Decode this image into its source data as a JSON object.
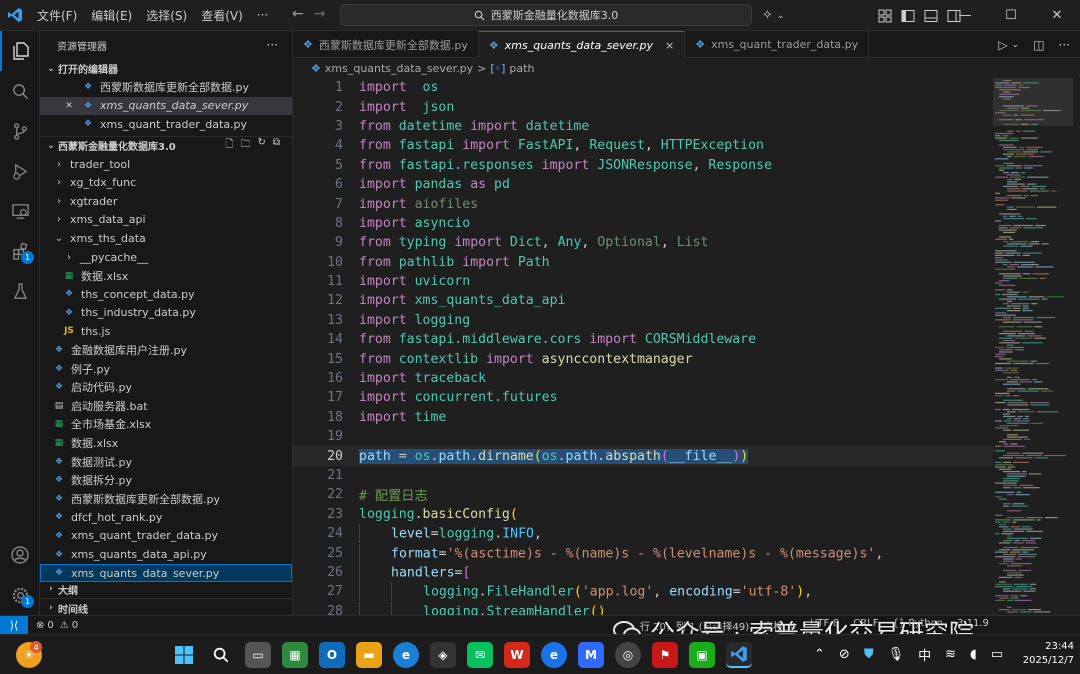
{
  "menu": [
    "文件(F)",
    "编辑(E)",
    "选择(S)",
    "查看(V)",
    "···"
  ],
  "search": {
    "text": "西蒙斯金融量化数据库3.0"
  },
  "explorer": {
    "title": "资源管理器",
    "more": "···",
    "open_editors_label": "打开的编辑器",
    "open_editors": [
      {
        "name": "西蒙斯数据库更新全部数据.py",
        "active": false
      },
      {
        "name": "xms_quants_data_sever.py",
        "active": true
      },
      {
        "name": "xms_quant_trader_data.py",
        "active": false
      }
    ],
    "workspace": "西蒙斯金融量化数据库3.0",
    "tree": [
      {
        "name": "trader_tool",
        "kind": "folder",
        "depth": 1
      },
      {
        "name": "xg_tdx_func",
        "kind": "folder",
        "depth": 1
      },
      {
        "name": "xgtrader",
        "kind": "folder",
        "depth": 1
      },
      {
        "name": "xms_data_api",
        "kind": "folder",
        "depth": 1
      },
      {
        "name": "xms_ths_data",
        "kind": "folder-open",
        "depth": 1
      },
      {
        "name": "__pycache__",
        "kind": "folder",
        "depth": 2
      },
      {
        "name": "数据.xlsx",
        "kind": "xlsx",
        "depth": 2
      },
      {
        "name": "ths_concept_data.py",
        "kind": "py",
        "depth": 2
      },
      {
        "name": "ths_industry_data.py",
        "kind": "py",
        "depth": 2
      },
      {
        "name": "ths.js",
        "kind": "js",
        "depth": 2
      },
      {
        "name": "金融数据库用户注册.py",
        "kind": "py",
        "depth": 1
      },
      {
        "name": "例子.py",
        "kind": "py",
        "depth": 1
      },
      {
        "name": "启动代码.py",
        "kind": "py",
        "depth": 1
      },
      {
        "name": "启动服务器.bat",
        "kind": "bat",
        "depth": 1
      },
      {
        "name": "全市场基金.xlsx",
        "kind": "xlsx",
        "depth": 1
      },
      {
        "name": "数据.xlsx",
        "kind": "xlsx",
        "depth": 1
      },
      {
        "name": "数据测试.py",
        "kind": "py",
        "depth": 1
      },
      {
        "name": "数据拆分.py",
        "kind": "py",
        "depth": 1
      },
      {
        "name": "西蒙斯数据库更新全部数据.py",
        "kind": "py",
        "depth": 1
      },
      {
        "name": "dfcf_hot_rank.py",
        "kind": "py",
        "depth": 1
      },
      {
        "name": "xms_quant_trader_data.py",
        "kind": "py",
        "depth": 1
      },
      {
        "name": "xms_quants_data_api.py",
        "kind": "py",
        "depth": 1
      },
      {
        "name": "xms_quants_data_sever.py",
        "kind": "py",
        "depth": 1,
        "focus": true
      }
    ],
    "outline_label": "大纲",
    "timeline_label": "时间线"
  },
  "tabs": [
    {
      "name": "西蒙斯数据库更新全部数据.py",
      "active": false
    },
    {
      "name": "xms_quants_data_sever.py",
      "active": true,
      "close": "×"
    },
    {
      "name": "xms_quant_trader_data.py",
      "active": false
    }
  ],
  "breadcrumb": {
    "file": "xms_quants_data_sever.py",
    "sep": ">",
    "symbol": "path"
  },
  "code": {
    "current_line": 20,
    "lines": [
      {
        "n": "1",
        "t": [
          [
            "k",
            "import"
          ],
          [
            "",
            "  "
          ],
          [
            "m",
            "os"
          ]
        ]
      },
      {
        "n": "2",
        "t": [
          [
            "k",
            "import"
          ],
          [
            "",
            "  "
          ],
          [
            "m",
            "json"
          ]
        ]
      },
      {
        "n": "3",
        "t": [
          [
            "k",
            "from"
          ],
          [
            "",
            " "
          ],
          [
            "m",
            "datetime"
          ],
          [
            "",
            " "
          ],
          [
            "k",
            "import"
          ],
          [
            "",
            " "
          ],
          [
            "m",
            "datetime"
          ]
        ]
      },
      {
        "n": "4",
        "t": [
          [
            "k",
            "from"
          ],
          [
            "",
            " "
          ],
          [
            "m",
            "fastapi"
          ],
          [
            "",
            " "
          ],
          [
            "k",
            "import"
          ],
          [
            "",
            " "
          ],
          [
            "m",
            "FastAPI"
          ],
          [
            "",
            ", "
          ],
          [
            "m",
            "Request"
          ],
          [
            "",
            ", "
          ],
          [
            "m",
            "HTTPException"
          ]
        ]
      },
      {
        "n": "5",
        "t": [
          [
            "k",
            "from"
          ],
          [
            "",
            " "
          ],
          [
            "m",
            "fastapi.responses"
          ],
          [
            "",
            " "
          ],
          [
            "k",
            "import"
          ],
          [
            "",
            " "
          ],
          [
            "m",
            "JSONResponse"
          ],
          [
            "",
            ", "
          ],
          [
            "m",
            "Response"
          ]
        ]
      },
      {
        "n": "6",
        "t": [
          [
            "k",
            "import"
          ],
          [
            "",
            " "
          ],
          [
            "m",
            "pandas"
          ],
          [
            "",
            " "
          ],
          [
            "k",
            "as"
          ],
          [
            "",
            " "
          ],
          [
            "m",
            "pd"
          ]
        ]
      },
      {
        "n": "7",
        "t": [
          [
            "k",
            "import"
          ],
          [
            "",
            " "
          ],
          [
            "dim",
            "aiofiles"
          ]
        ]
      },
      {
        "n": "8",
        "t": [
          [
            "k",
            "import"
          ],
          [
            "",
            " "
          ],
          [
            "m",
            "asyncio"
          ]
        ]
      },
      {
        "n": "9",
        "t": [
          [
            "k",
            "from"
          ],
          [
            "",
            " "
          ],
          [
            "m",
            "typing"
          ],
          [
            "",
            " "
          ],
          [
            "k",
            "import"
          ],
          [
            "",
            " "
          ],
          [
            "m",
            "Dict"
          ],
          [
            "",
            ", "
          ],
          [
            "m",
            "Any"
          ],
          [
            "",
            ", "
          ],
          [
            "dim",
            "Optional"
          ],
          [
            "",
            ", "
          ],
          [
            "dim",
            "List"
          ]
        ]
      },
      {
        "n": "10",
        "t": [
          [
            "k",
            "from"
          ],
          [
            "",
            " "
          ],
          [
            "m",
            "pathlib"
          ],
          [
            "",
            " "
          ],
          [
            "k",
            "import"
          ],
          [
            "",
            " "
          ],
          [
            "m",
            "Path"
          ]
        ]
      },
      {
        "n": "11",
        "t": [
          [
            "k",
            "import"
          ],
          [
            "",
            " "
          ],
          [
            "m",
            "uvicorn"
          ]
        ]
      },
      {
        "n": "12",
        "t": [
          [
            "k",
            "import"
          ],
          [
            "",
            " "
          ],
          [
            "m",
            "xms_quants_data_api"
          ]
        ]
      },
      {
        "n": "13",
        "t": [
          [
            "k",
            "import"
          ],
          [
            "",
            " "
          ],
          [
            "m",
            "logging"
          ]
        ]
      },
      {
        "n": "14",
        "t": [
          [
            "k",
            "from"
          ],
          [
            "",
            " "
          ],
          [
            "m",
            "fastapi.middleware.cors"
          ],
          [
            "",
            " "
          ],
          [
            "k",
            "import"
          ],
          [
            "",
            " "
          ],
          [
            "m",
            "CORSMiddleware"
          ]
        ]
      },
      {
        "n": "15",
        "t": [
          [
            "k",
            "from"
          ],
          [
            "",
            " "
          ],
          [
            "m",
            "contextlib"
          ],
          [
            "",
            " "
          ],
          [
            "k",
            "import"
          ],
          [
            "",
            " "
          ],
          [
            "f",
            "asynccontextmanager"
          ]
        ]
      },
      {
        "n": "16",
        "t": [
          [
            "k",
            "import"
          ],
          [
            "",
            " "
          ],
          [
            "m",
            "traceback"
          ]
        ]
      },
      {
        "n": "17",
        "t": [
          [
            "k",
            "import"
          ],
          [
            "",
            " "
          ],
          [
            "m",
            "concurrent.futures"
          ]
        ]
      },
      {
        "n": "18",
        "t": [
          [
            "k",
            "import"
          ],
          [
            "",
            " "
          ],
          [
            "m",
            "time"
          ]
        ]
      },
      {
        "n": "19",
        "t": []
      },
      {
        "n": "20",
        "hl": true,
        "t": [
          [
            "v",
            "path"
          ],
          [
            "",
            " = "
          ],
          [
            "m",
            "os"
          ],
          [
            "",
            "."
          ],
          [
            "v",
            "path"
          ],
          [
            "",
            "."
          ],
          [
            "f",
            "dirname"
          ],
          [
            "p",
            "("
          ],
          [
            "m",
            "os"
          ],
          [
            "",
            "."
          ],
          [
            "v",
            "path"
          ],
          [
            "",
            "."
          ],
          [
            "f",
            "abspath"
          ],
          [
            "p2",
            "("
          ],
          [
            "v",
            "__file__"
          ],
          [
            "p2",
            ")"
          ],
          [
            "p",
            ")"
          ]
        ]
      },
      {
        "n": "21",
        "t": []
      },
      {
        "n": "22",
        "t": [
          [
            "c",
            "# 配置日志"
          ]
        ]
      },
      {
        "n": "23",
        "t": [
          [
            "m",
            "logging"
          ],
          [
            "",
            "."
          ],
          [
            "f",
            "basicConfig"
          ],
          [
            "p",
            "("
          ]
        ]
      },
      {
        "n": "24",
        "t": [
          [
            "i1",
            ""
          ],
          [
            "v",
            "level"
          ],
          [
            "",
            "="
          ],
          [
            "m",
            "logging"
          ],
          [
            "",
            "."
          ],
          [
            "d",
            "INFO"
          ],
          [
            "",
            ","
          ]
        ]
      },
      {
        "n": "25",
        "t": [
          [
            "i1",
            ""
          ],
          [
            "v",
            "format"
          ],
          [
            "",
            "="
          ],
          [
            "s",
            "'%(asctime)s - %(name)s - %(levelname)s - %(message)s'"
          ],
          [
            "",
            ","
          ]
        ]
      },
      {
        "n": "26",
        "t": [
          [
            "i1",
            ""
          ],
          [
            "v",
            "handlers"
          ],
          [
            "",
            "="
          ],
          [
            "p2",
            "["
          ]
        ]
      },
      {
        "n": "27",
        "t": [
          [
            "i1",
            ""
          ],
          [
            "i1",
            ""
          ],
          [
            "m",
            "logging"
          ],
          [
            "",
            "."
          ],
          [
            "m",
            "FileHandler"
          ],
          [
            "p",
            "("
          ],
          [
            "s",
            "'app.log'"
          ],
          [
            "",
            ", "
          ],
          [
            "v",
            "encoding"
          ],
          [
            "",
            "="
          ],
          [
            "s",
            "'utf-8'"
          ],
          [
            "p",
            ")"
          ],
          [
            "",
            ","
          ]
        ]
      },
      {
        "n": "28",
        "t": [
          [
            "i1",
            ""
          ],
          [
            "i1",
            ""
          ],
          [
            "m",
            "logging"
          ],
          [
            "",
            "."
          ],
          [
            "m",
            "StreamHandler"
          ],
          [
            "p",
            "()"
          ]
        ]
      }
    ]
  },
  "status": {
    "errors": "0",
    "warnings": "0",
    "items": [
      "行 20，列 1 (已选择49)",
      "空格: 4",
      "UTF-8",
      "CRLF",
      "{} Python",
      "3.11.9"
    ]
  },
  "watermark": "公众号 · 索普量化交易研究院",
  "taskbar": {
    "clock_time": "23:44",
    "clock_date": "2025/12/7",
    "ime": "中",
    "weather_badge": "4"
  },
  "colors": {
    "accent": "#0078d4",
    "keyword": "#c586c0",
    "module": "#4ec9b0",
    "variable": "#9cdcfe",
    "function": "#dcdcaa",
    "string": "#ce9178",
    "comment": "#6a9955"
  }
}
